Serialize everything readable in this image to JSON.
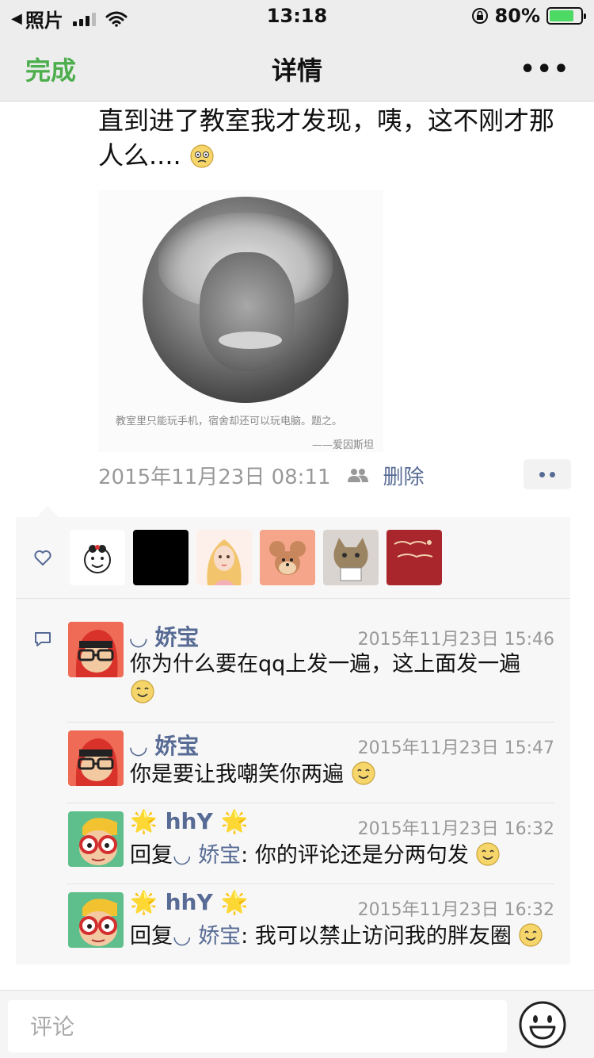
{
  "status_bar": {
    "back_app": "照片",
    "time": "13:18",
    "battery_percent": "80%",
    "battery_level": 0.8,
    "icons": [
      "back-arrow-icon",
      "signal-icon",
      "wifi-icon",
      "rotation-lock-icon",
      "battery-charging-icon"
    ]
  },
  "nav": {
    "done_label": "完成",
    "title": "详情",
    "more_label": "•••"
  },
  "post": {
    "text": "直到进了教室我才发现，咦，这不刚才那人么....",
    "image": {
      "caption": "教室里只能玩手机，宿舍却还可以玩电脑。题之。",
      "author": "——爱因斯坦"
    },
    "time": "2015年11月23日 08:11",
    "delete_label": "删除"
  },
  "likes": {
    "icon": "heart-outline-icon",
    "avatars": [
      "avatar-cartoon-face",
      "avatar-black",
      "avatar-anime-girl",
      "avatar-jerry-mouse",
      "avatar-cat",
      "avatar-red-card"
    ]
  },
  "comments": [
    {
      "name": "◡ 娇宝",
      "time": "2015年11月23日 15:46",
      "text": "你为什么要在qq上发一遍，这上面发一遍",
      "avatar": "avatar-red-hood"
    },
    {
      "name": "◡ 娇宝",
      "time": "2015年11月23日 15:47",
      "text": "你是要让我嘲笑你两遍",
      "avatar": "avatar-red-hood"
    },
    {
      "name": "🌟 hhY 🌟",
      "time": "2015年11月23日 16:32",
      "reply_prefix": "回复",
      "reply_to": "◡ 娇宝",
      "text": ": 你的评论还是分两句发",
      "avatar": "avatar-glasses-boy"
    },
    {
      "name": "🌟 hhY 🌟",
      "time": "2015年11月23日 16:32",
      "reply_prefix": "回复",
      "reply_to": "◡ 娇宝",
      "text": ": 我可以禁止访问我的胖友圈",
      "avatar": "avatar-glasses-boy"
    }
  ],
  "input": {
    "placeholder": "评论",
    "emoji_button": "smiley-icon"
  },
  "colors": {
    "link_blue": "#576b95",
    "done_green": "#4cae4c",
    "panel_bg": "#f7f7f7"
  }
}
